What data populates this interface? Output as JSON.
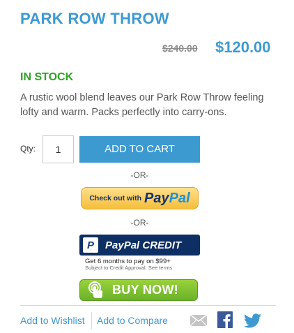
{
  "product": {
    "title": "PARK ROW THROW",
    "old_price": "$240.00",
    "price": "$120.00",
    "stock": "IN STOCK",
    "description": "A rustic wool blend leaves our Park Row Throw feeling lofty and warm. Packs perfectly into carry-ons."
  },
  "cart": {
    "qty_label": "Qty:",
    "qty_value": "1",
    "add_to_cart": "ADD TO CART",
    "or1": "-OR-",
    "or2": "-OR-"
  },
  "paypal": {
    "checkout_prefix": "Check out with",
    "brand_pay": "Pay",
    "brand_pal": "Pal",
    "credit_label": "PayPal CREDIT",
    "credit_logo": "P",
    "credit_note": "Get 6 months to pay on $99+",
    "credit_sub": "Subject to Credit Approval. See terms"
  },
  "buy_now": {
    "label": "BUY NOW!"
  },
  "links": {
    "wishlist": "Add to Wishlist",
    "compare": "Add to Compare"
  },
  "colors": {
    "accent": "#3d9ad1",
    "stock": "#2fa324",
    "paypal_navy": "#0d2f63",
    "buy_now_green": "#6ab22a"
  },
  "icons": [
    "mail-icon",
    "facebook-icon",
    "twitter-icon",
    "hand-tap-icon",
    "paypal-logo-icon"
  ]
}
